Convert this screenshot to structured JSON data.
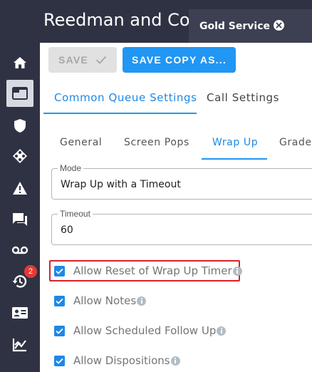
{
  "header": {
    "app_title": "Reedman and Co",
    "open_tab": "Gold Service"
  },
  "sidebar": {
    "items": [
      {
        "icon": "home-icon"
      },
      {
        "icon": "browser-window-icon",
        "active": true
      },
      {
        "icon": "shield-icon"
      },
      {
        "icon": "routing-diamond-icon"
      },
      {
        "icon": "warning-icon"
      },
      {
        "icon": "chat-icon"
      },
      {
        "icon": "voicemail-icon"
      },
      {
        "icon": "history-icon",
        "badge": "2"
      },
      {
        "icon": "contact-card-icon"
      },
      {
        "icon": "chart-icon"
      }
    ]
  },
  "toolbar": {
    "save_label": "SAVE",
    "save_copy_label": "SAVE COPY AS..."
  },
  "primary_tabs": {
    "common": "Common Queue Settings",
    "call": "Call Settings"
  },
  "secondary_tabs": {
    "general": "General",
    "screen_pops": "Screen Pops",
    "wrap_up": "Wrap Up",
    "grade": "Grade"
  },
  "fields": {
    "mode_label": "Mode",
    "mode_value": "Wrap Up with a Timeout",
    "timeout_label": "Timeout",
    "timeout_value": "60"
  },
  "checkboxes": {
    "reset_timer": "Allow Reset of Wrap Up Timer",
    "notes": "Allow Notes",
    "followup": "Allow Scheduled Follow Up",
    "dispositions": "Allow Dispositions"
  },
  "colors": {
    "accent": "#2196f3",
    "sidebar_bg": "#2f3243",
    "highlight": "#d9212a",
    "badge": "#e53935"
  }
}
